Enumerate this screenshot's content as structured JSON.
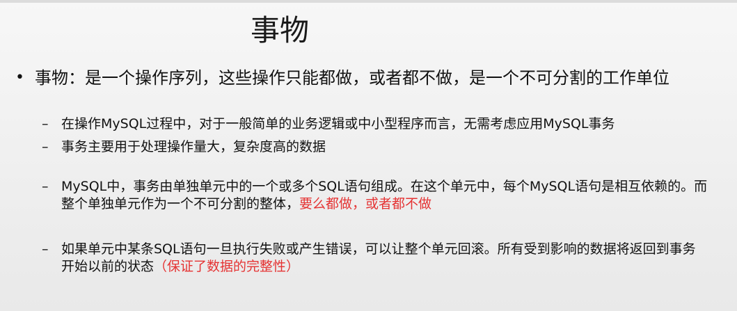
{
  "slide": {
    "title": "事物",
    "bullet": {
      "marker": "•",
      "text": "事物：是一个操作序列，这些操作只能都做，或者都不做，是一个不可分割的工作单位"
    },
    "sub_items": [
      {
        "marker": "–",
        "text": "在操作MySQL过程中，对于一般简单的业务逻辑或中小型程序而言，无需考虑应用MySQL事务",
        "highlight": ""
      },
      {
        "marker": "–",
        "text": "事务主要用于处理操作量大，复杂度高的数据",
        "highlight": ""
      },
      {
        "marker": "–",
        "text": "MySQL中，事务由单独单元中的一个或多个SQL语句组成。在这个单元中，每个MySQL语句是相互依赖的。而整个单独单元作为一个不可分割的整体，",
        "highlight": "要么都做，或者都不做"
      },
      {
        "marker": "–",
        "text": "如果单元中某条SQL语句一旦执行失败或产生错误，可以让整个单元回滚。所有受到影响的数据将返回到事务开始以前的状态",
        "highlight": "（保证了数据的完整性）"
      }
    ],
    "colors": {
      "text": "#111111",
      "highlight": "#e53333",
      "background": "#f0f0f0"
    }
  }
}
